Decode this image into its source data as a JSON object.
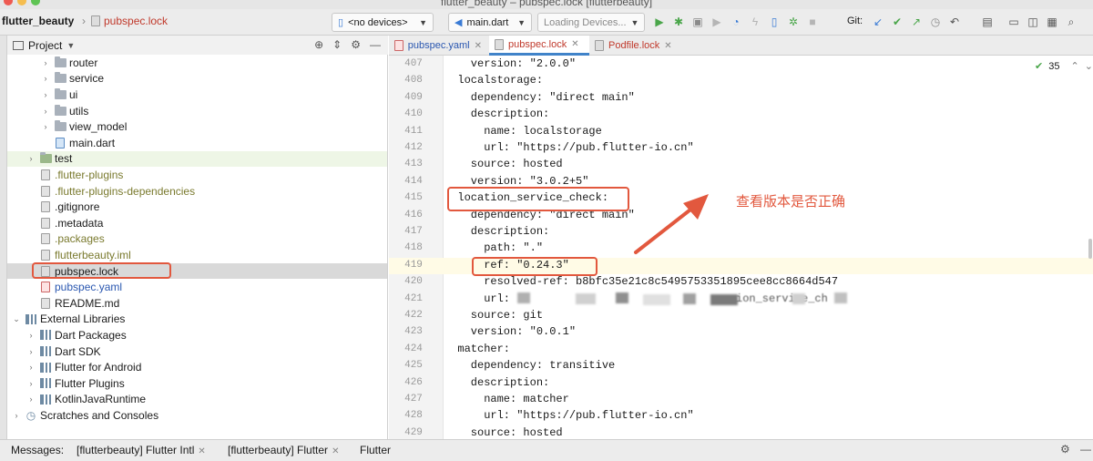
{
  "window": {
    "title": "flutter_beauty – pubspec.lock [flutterbeauty]"
  },
  "toolbar": {
    "project_name": "flutter_beauty",
    "file_name": "pubspec.lock",
    "device_select": "<no devices>",
    "run_config": "main.dart",
    "loading_devices": "Loading Devices...",
    "git_label": "Git:"
  },
  "project_panel": {
    "title": "Project"
  },
  "tree": {
    "items": [
      {
        "label": "router",
        "kind": "folder",
        "indent": 2,
        "chev": "›",
        "color": "#1a1a1a"
      },
      {
        "label": "service",
        "kind": "folder",
        "indent": 2,
        "chev": "›",
        "color": "#1a1a1a"
      },
      {
        "label": "ui",
        "kind": "folder",
        "indent": 2,
        "chev": "›",
        "color": "#1a1a1a"
      },
      {
        "label": "utils",
        "kind": "folder",
        "indent": 2,
        "chev": "›",
        "color": "#1a1a1a"
      },
      {
        "label": "view_model",
        "kind": "folder",
        "indent": 2,
        "chev": "›",
        "color": "#1a1a1a"
      },
      {
        "label": "main.dart",
        "kind": "dart",
        "indent": 2,
        "chev": "",
        "color": "#1a1a1a"
      },
      {
        "label": "test",
        "kind": "folder",
        "indent": 1,
        "chev": "›",
        "color": "#1a1a1a"
      },
      {
        "label": ".flutter-plugins",
        "kind": "file",
        "indent": 1,
        "chev": "",
        "color": "#7a7a2e"
      },
      {
        "label": ".flutter-plugins-dependencies",
        "kind": "file",
        "indent": 1,
        "chev": "",
        "color": "#7a7a2e"
      },
      {
        "label": ".gitignore",
        "kind": "file",
        "indent": 1,
        "chev": "",
        "color": "#1a1a1a"
      },
      {
        "label": ".metadata",
        "kind": "file",
        "indent": 1,
        "chev": "",
        "color": "#1a1a1a"
      },
      {
        "label": ".packages",
        "kind": "file",
        "indent": 1,
        "chev": "",
        "color": "#7a7a2e"
      },
      {
        "label": "flutterbeauty.iml",
        "kind": "file",
        "indent": 1,
        "chev": "",
        "color": "#7a7a2e"
      },
      {
        "label": "pubspec.lock",
        "kind": "lock",
        "indent": 1,
        "chev": "",
        "color": "#1a1a1a"
      },
      {
        "label": "pubspec.yaml",
        "kind": "yaml",
        "indent": 1,
        "chev": "",
        "color": "#2a57b0"
      },
      {
        "label": "README.md",
        "kind": "file",
        "indent": 1,
        "chev": "",
        "color": "#1a1a1a"
      },
      {
        "label": "External Libraries",
        "kind": "lib",
        "indent": 0,
        "chev": "⌄",
        "color": "#1a1a1a"
      },
      {
        "label": "Dart Packages",
        "kind": "lib",
        "indent": 1,
        "chev": "›",
        "color": "#1a1a1a"
      },
      {
        "label": "Dart SDK",
        "kind": "lib",
        "indent": 1,
        "chev": "›",
        "color": "#1a1a1a"
      },
      {
        "label": "Flutter for Android",
        "kind": "lib",
        "indent": 1,
        "chev": "›",
        "color": "#1a1a1a"
      },
      {
        "label": "Flutter Plugins",
        "kind": "lib",
        "indent": 1,
        "chev": "›",
        "color": "#1a1a1a"
      },
      {
        "label": "KotlinJavaRuntime",
        "kind": "lib",
        "indent": 1,
        "chev": "›",
        "color": "#1a1a1a"
      },
      {
        "label": "Scratches and Consoles",
        "kind": "scratch",
        "indent": 0,
        "chev": "›",
        "color": "#1a1a1a"
      }
    ]
  },
  "tabs": [
    {
      "label": "pubspec.yaml",
      "kind": "yaml"
    },
    {
      "label": "pubspec.lock",
      "kind": "lock"
    },
    {
      "label": "Podfile.lock",
      "kind": "lock"
    }
  ],
  "editor": {
    "check_count": "35",
    "lines": [
      {
        "n": "407",
        "t": "    version: \"2.0.0\""
      },
      {
        "n": "408",
        "t": "  localstorage:"
      },
      {
        "n": "409",
        "t": "    dependency: \"direct main\""
      },
      {
        "n": "410",
        "t": "    description:"
      },
      {
        "n": "411",
        "t": "      name: localstorage"
      },
      {
        "n": "412",
        "t": "      url: \"https://pub.flutter-io.cn\""
      },
      {
        "n": "413",
        "t": "    source: hosted"
      },
      {
        "n": "414",
        "t": "    version: \"3.0.2+5\""
      },
      {
        "n": "415",
        "t": "  location_service_check:"
      },
      {
        "n": "416",
        "t": "    dependency: \"direct main\""
      },
      {
        "n": "417",
        "t": "    description:"
      },
      {
        "n": "418",
        "t": "      path: \".\""
      },
      {
        "n": "419",
        "t": "      ref: \"0.24.3\""
      },
      {
        "n": "420",
        "t": "      resolved-ref: b8bfc35e21c8c5495753351895cee8cc8664d547"
      },
      {
        "n": "421",
        "t": "      url: "
      },
      {
        "n": "422",
        "t": "    source: git"
      },
      {
        "n": "423",
        "t": "    version: \"0.0.1\""
      },
      {
        "n": "424",
        "t": "  matcher:"
      },
      {
        "n": "425",
        "t": "    dependency: transitive"
      },
      {
        "n": "426",
        "t": "    description:"
      },
      {
        "n": "427",
        "t": "      name: matcher"
      },
      {
        "n": "428",
        "t": "      url: \"https://pub.flutter-io.cn\""
      },
      {
        "n": "429",
        "t": "    source: hosted"
      }
    ],
    "blurred_fragment": "ion_service_ch"
  },
  "annotation": {
    "text": "查看版本是否正确"
  },
  "bottom": {
    "messages_label": "Messages:",
    "items": [
      "[flutterbeauty] Flutter Intl",
      "[flutterbeauty] Flutter",
      "Flutter"
    ]
  },
  "colors": {
    "accent": "#4083c9",
    "annotation": "#e2583e"
  }
}
